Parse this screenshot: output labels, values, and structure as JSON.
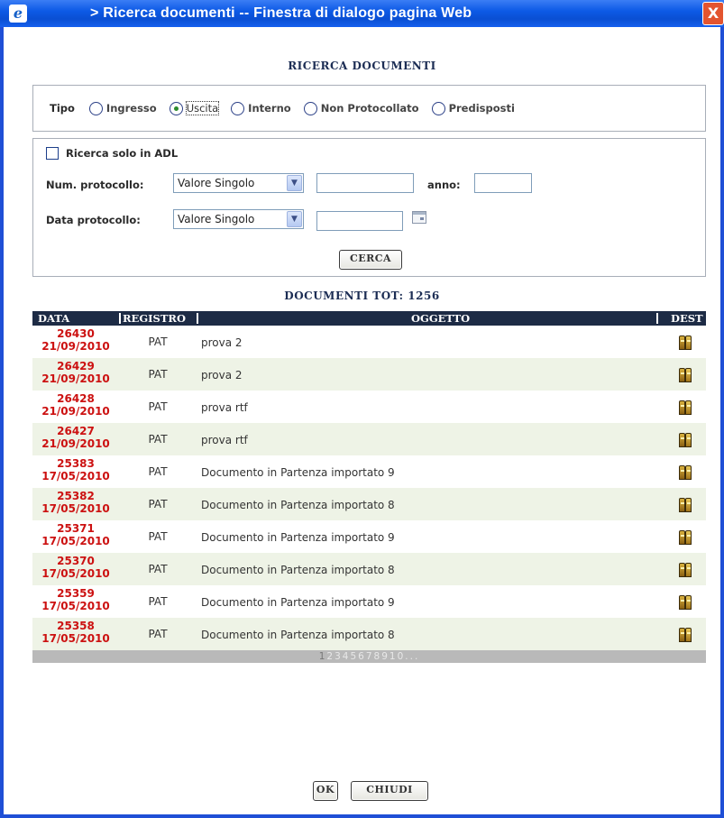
{
  "window": {
    "title": "> Ricerca documenti -- Finestra di dialogo pagina Web",
    "close": "X"
  },
  "heading": "RICERCA DOCUMENTI",
  "tipo": {
    "label": "Tipo",
    "options": [
      "Ingresso",
      "Uscita",
      "Interno",
      "Non Protocollato",
      "Predisposti"
    ],
    "selected": "Uscita"
  },
  "filters": {
    "adl_label": "Ricerca solo in ADL",
    "num_label": "Num. protocollo:",
    "num_select": "Valore Singolo",
    "anno_label": "anno:",
    "data_label": "Data protocollo:",
    "data_select": "Valore Singolo",
    "search_button": "CERCA"
  },
  "total_label": "DOCUMENTI TOT: 1256",
  "grid": {
    "columns": [
      "DATA",
      "REGISTRO",
      "OGGETTO",
      "DEST"
    ],
    "rows": [
      {
        "num": "26430",
        "date": "21/09/2010",
        "registro": "PAT",
        "oggetto": "prova 2"
      },
      {
        "num": "26429",
        "date": "21/09/2010",
        "registro": "PAT",
        "oggetto": "prova 2"
      },
      {
        "num": "26428",
        "date": "21/09/2010",
        "registro": "PAT",
        "oggetto": "prova rtf"
      },
      {
        "num": "26427",
        "date": "21/09/2010",
        "registro": "PAT",
        "oggetto": "prova rtf"
      },
      {
        "num": "25383",
        "date": "17/05/2010",
        "registro": "PAT",
        "oggetto": "Documento in Partenza importato 9"
      },
      {
        "num": "25382",
        "date": "17/05/2010",
        "registro": "PAT",
        "oggetto": "Documento in Partenza importato 8"
      },
      {
        "num": "25371",
        "date": "17/05/2010",
        "registro": "PAT",
        "oggetto": "Documento in Partenza importato 9"
      },
      {
        "num": "25370",
        "date": "17/05/2010",
        "registro": "PAT",
        "oggetto": "Documento in Partenza importato 8"
      },
      {
        "num": "25359",
        "date": "17/05/2010",
        "registro": "PAT",
        "oggetto": "Documento in Partenza importato 9"
      },
      {
        "num": "25358",
        "date": "17/05/2010",
        "registro": "PAT",
        "oggetto": "Documento in Partenza importato 8"
      }
    ],
    "pager": [
      "1",
      "2",
      "3",
      "4",
      "5",
      "6",
      "7",
      "8",
      "9",
      "10",
      "..."
    ]
  },
  "footer": {
    "ok": "OK",
    "chiudi": "CHIUDI"
  }
}
